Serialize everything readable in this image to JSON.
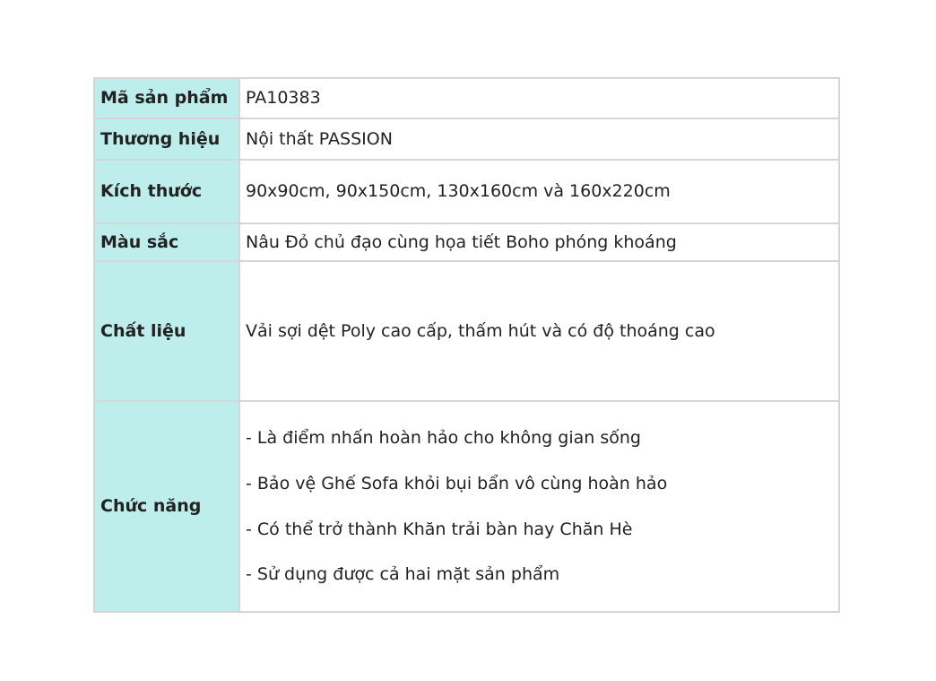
{
  "spec_table": {
    "rows": [
      {
        "label": "Mã sản phẩm",
        "value": "PA10383"
      },
      {
        "label": "Thương hiệu",
        "value": "Nội thất PASSION"
      },
      {
        "label": "Kích thước",
        "value": "90x90cm, 90x150cm, 130x160cm và 160x220cm"
      },
      {
        "label": "Màu sắc",
        "value": "Nâu Đỏ chủ đạo cùng họa tiết Boho phóng khoáng"
      },
      {
        "label": "Chất liệu",
        "value": "Vải sợi dệt Poly cao cấp, thấm hút và có độ thoáng cao"
      },
      {
        "label": "Chức năng",
        "bullets": [
          "- Là điểm nhấn hoàn hảo cho không gian sống",
          "- Bảo vệ Ghế Sofa khỏi bụi bẩn vô cùng hoàn hảo",
          "- Có thể trở thành Khăn trải bàn hay Chăn Hè",
          "- Sử dụng được cả hai mặt sản phẩm"
        ]
      }
    ]
  },
  "colors": {
    "label_background": "#bdeeec",
    "border": "#d6d6d6",
    "text": "#222222"
  }
}
